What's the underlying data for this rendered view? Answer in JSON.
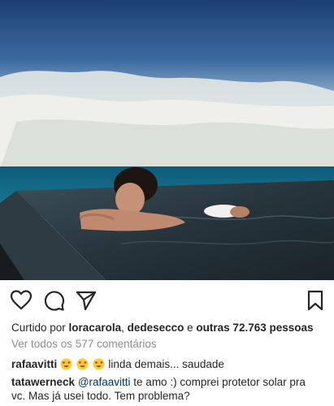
{
  "post": {
    "liked_prefix": "Curtido por ",
    "liked_user1": "loracarola",
    "liked_sep": ", ",
    "liked_user2": "dedesecco",
    "liked_and": " e ",
    "liked_others": "outras 72.763 pessoas",
    "view_all_comments": "Ver todos os 577 comentários"
  },
  "comments": [
    {
      "user": "rafaavitti",
      "text": "linda demais... saudade",
      "emoji": "heart-eyes-emoji"
    },
    {
      "user": "tatawerneck",
      "mention": "@rafaavitti",
      "text_line1": " te amo :) comprei protetor solar pra",
      "text_line2": "vc. Mas já usei todo. Tem problema?"
    }
  ],
  "icons": {
    "like": "heart-icon",
    "comment": "comment-bubble-icon",
    "share": "paper-plane-icon",
    "save": "bookmark-icon"
  },
  "colors": {
    "text": "#262626",
    "muted": "#8e8e8e",
    "mention": "#003569"
  }
}
